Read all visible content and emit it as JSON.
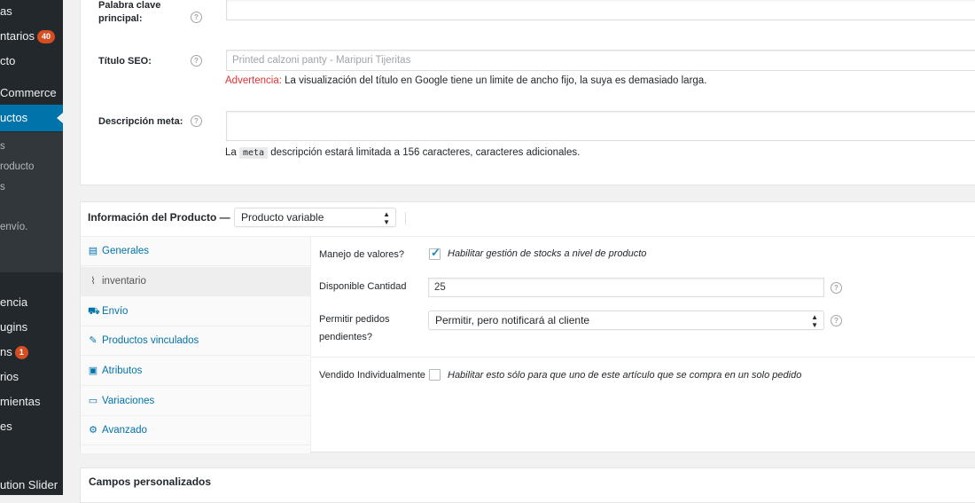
{
  "sidebar": {
    "items": [
      {
        "label": "as"
      },
      {
        "label": "ntarios",
        "badge": "40"
      },
      {
        "label": "cto"
      },
      {
        "label": "Commerce"
      },
      {
        "label": "uctos"
      },
      {
        "label": "s"
      },
      {
        "label": "roducto"
      },
      {
        "label": "s"
      },
      {
        "label": "envío."
      },
      {
        "label": "encia"
      },
      {
        "label": "ugins"
      },
      {
        "label": "ns",
        "badge": "1"
      },
      {
        "label": "rios"
      },
      {
        "label": "mientas"
      },
      {
        "label": "es"
      },
      {
        "label": "ution Slider"
      }
    ]
  },
  "seo": {
    "focus_keyword_label": "Palabra clave principal:",
    "focus_keyword_value": "",
    "title_label": "Título SEO:",
    "title_placeholder": "Printed calzoni panty  - Maripuri Tijeritas",
    "warning_prefix": "Advertencia:",
    "warning_text": " La visualización del título en Google tiene un limite de ancho fijo, la suya es demasiado larga.",
    "meta_label": "Descripción meta:",
    "meta_value": "",
    "meta_note_pre": "La ",
    "meta_note_code": "meta",
    "meta_note_post": " descripción estará limitada a 156 caracteres, caracteres adicionales.",
    "help_glyph": "?"
  },
  "product_data": {
    "title": "Información del Producto —",
    "type_select": "Producto variable",
    "tabs": [
      {
        "label": "Generales",
        "icon": "general-icon"
      },
      {
        "label": "inventario",
        "icon": "inventory-icon"
      },
      {
        "label": "Envío",
        "icon": "shipping-icon"
      },
      {
        "label": "Productos vinculados",
        "icon": "link-icon"
      },
      {
        "label": "Atributos",
        "icon": "attributes-icon"
      },
      {
        "label": "Variaciones",
        "icon": "variations-icon"
      },
      {
        "label": "Avanzado",
        "icon": "advanced-icon"
      }
    ],
    "active_tab": "inventario",
    "fields": {
      "manage_stock_label": "Manejo de valores?",
      "manage_stock_checked": true,
      "manage_stock_desc": "Habilitar gestión de stocks a nivel de producto",
      "stock_qty_label": "Disponible Cantidad",
      "stock_qty_value": "25",
      "backorders_label_1": "Permitir pedidos",
      "backorders_label_2": "pendientes?",
      "backorders_value": "Permitir, pero notificará al cliente",
      "sold_individually_label": "Vendido Individualmente",
      "sold_individually_checked": false,
      "sold_individually_desc": "Habilitar esto sólo para que uno de este artículo que se compra en un solo pedido"
    }
  },
  "custom_fields": {
    "title": "Campos personalizados"
  },
  "colors": {
    "sidebar_bg": "#23282d",
    "sidebar_active": "#0073aa",
    "link": "#0073aa",
    "warning": "#dc3232",
    "badge": "#d54e21"
  }
}
